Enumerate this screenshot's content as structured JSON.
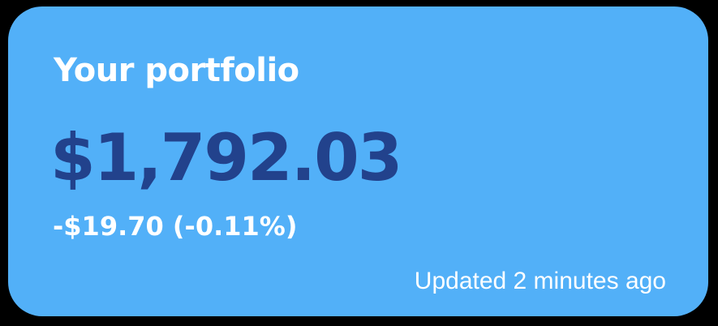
{
  "portfolio": {
    "title": "Your portfolio",
    "value": "$1,792.03",
    "change": "-$19.70 (-0.11%)",
    "updated": "Updated 2 minutes ago"
  },
  "colors": {
    "background": "#000000",
    "card": "#52b0f8",
    "value_text": "#22428c",
    "text": "#ffffff"
  }
}
